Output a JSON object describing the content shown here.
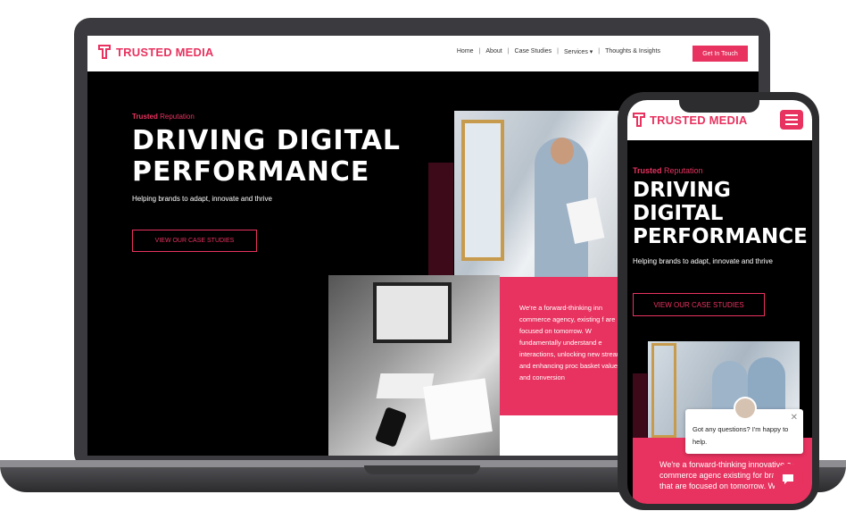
{
  "brand": {
    "name": "TRUSTED MEDIA",
    "accent": "#e8325f"
  },
  "desktop": {
    "nav": {
      "links": [
        "Home",
        "About",
        "Case Studies",
        "Services",
        "Thoughts & Insights"
      ],
      "services_caret": "▾",
      "cta": "Get In Touch"
    },
    "hero": {
      "kicker_bold": "Trusted",
      "kicker_rest": " Reputation",
      "title_line1": "DRIVING DIGITAL",
      "title_line2": "PERFORMANCE",
      "subtitle": "Helping brands to adapt, innovate and thrive",
      "button": "VIEW OUR CASE STUDIES"
    },
    "about_text": "We're a forward-thinking inn commerce agency, existing f are focused on tomorrow. W fundamentally understand e interactions, unlocking new streams and enhancing proc basket value and conversion"
  },
  "mobile": {
    "hero": {
      "kicker_bold": "Trusted",
      "kicker_rest": " Reputation",
      "title_line1": "DRIVING",
      "title_line2": "DIGITAL",
      "title_line3": "PERFORMANCE",
      "subtitle": "Helping brands to adapt, innovate and thrive",
      "button": "VIEW OUR CASE STUDIES"
    },
    "about_text": "We're a forward-thinking innovative e-commerce agenc existing for brands that are focused on tomorrow. We",
    "chat": {
      "message": "Got any questions? I'm happy to help.",
      "close": "✕"
    }
  }
}
